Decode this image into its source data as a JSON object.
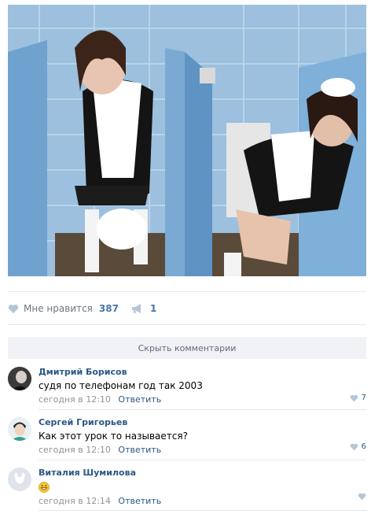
{
  "post": {
    "image_alt": "",
    "likes_label": "Мне нравится",
    "likes_count": "387",
    "shares_count": "1"
  },
  "comments_toggle": "Скрыть комментарии",
  "comments": [
    {
      "author": "Дмитрий Борисов",
      "text": "судя по телефонам год так 2003",
      "time": "сегодня в 12:10",
      "reply": "Ответить",
      "likes": "7"
    },
    {
      "author": "Сергей Григорьев",
      "text": "Как этот урок то называется?",
      "time": "сегодня в 12:10",
      "reply": "Ответить",
      "likes": "6"
    },
    {
      "author": "Виталия Шумилова",
      "text": "",
      "emoji": "grinning-face-emoji",
      "time": "сегодня в 12:14",
      "reply": "Ответить",
      "likes": ""
    }
  ],
  "colors": {
    "accent": "#2a5885",
    "muted": "#939393",
    "like_icon": "#b5c6d8",
    "bar_bg": "#f0f2f5"
  }
}
